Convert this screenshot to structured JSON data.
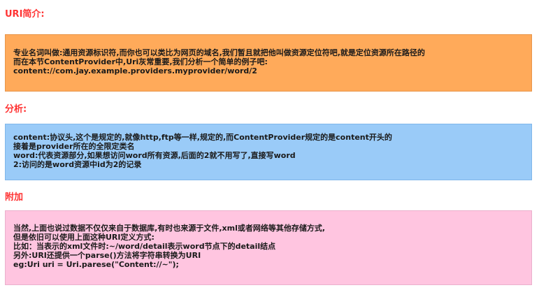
{
  "colors": {
    "heading": "#ff3333",
    "box1_bg": "#ffaa5a",
    "box2_bg": "#9acbf8",
    "box3_bg": "#ffc5e0"
  },
  "section1": {
    "heading": "URI简介:",
    "lines": [
      "专业名词叫做:通用资源标识符,而你也可以类比为网页的域名,我们暂且就把他叫做资源定位符吧,就是定位资源所在路径的",
      "而在本节ContentProvider中,Uri灰常重要,我们分析一个简单的例子吧:",
      "content://com.jay.example.providers.myprovider/word/2"
    ]
  },
  "section2": {
    "heading": "分析:",
    "lines": [
      "content:协议头,这个是规定的,就像http,ftp等一样,规定的,而ContentProvider规定的是content开头的",
      "接着是provider所在的全限定类名",
      "word:代表资源部分,如果想访问word所有资源,后面的2就不用写了,直接写word",
      "2:访问的是word资源中id为2的记录"
    ]
  },
  "section3": {
    "heading": "附加",
    "lines": [
      "当然,上面也说过数据不仅仅来自于数据库,有时也来源于文件,xml或者网络等其他存储方式,",
      "但是依旧可以使用上面这种URI定义方式:",
      "比如：当表示的xml文件时:~/word/detail表示word节点下的detail结点",
      "另外:URI还提供一个parse()方法将字符串转换为URI",
      "eg:Uri uri = Uri.parese(\"Content://~\");"
    ]
  }
}
